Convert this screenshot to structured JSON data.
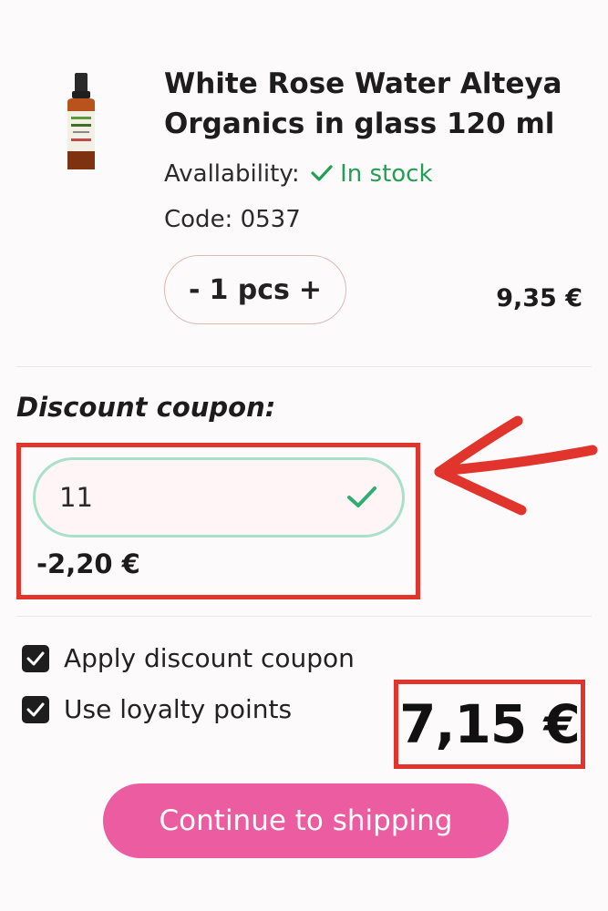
{
  "product": {
    "title_line1": "White Rose Water Alteya",
    "title_line2": "Organics in glass 120 ml",
    "availability_label": "Avallability:",
    "availability_status": "In stock",
    "code": "Code: 0537",
    "qty_minus": "-",
    "qty_value": "1 pcs",
    "qty_plus": "+",
    "price": "9,35 €"
  },
  "coupon": {
    "heading": "Discount coupon:",
    "value": "11",
    "discount": "-2,20 €"
  },
  "options": {
    "apply_coupon": "Apply discount coupon",
    "loyalty_points": "Use loyalty points"
  },
  "total": "7,15 €",
  "cta": "Continue to shipping",
  "colors": {
    "accent_pink": "#ec5ca0",
    "in_stock_green": "#22a052",
    "highlight_red": "#e0342c"
  }
}
